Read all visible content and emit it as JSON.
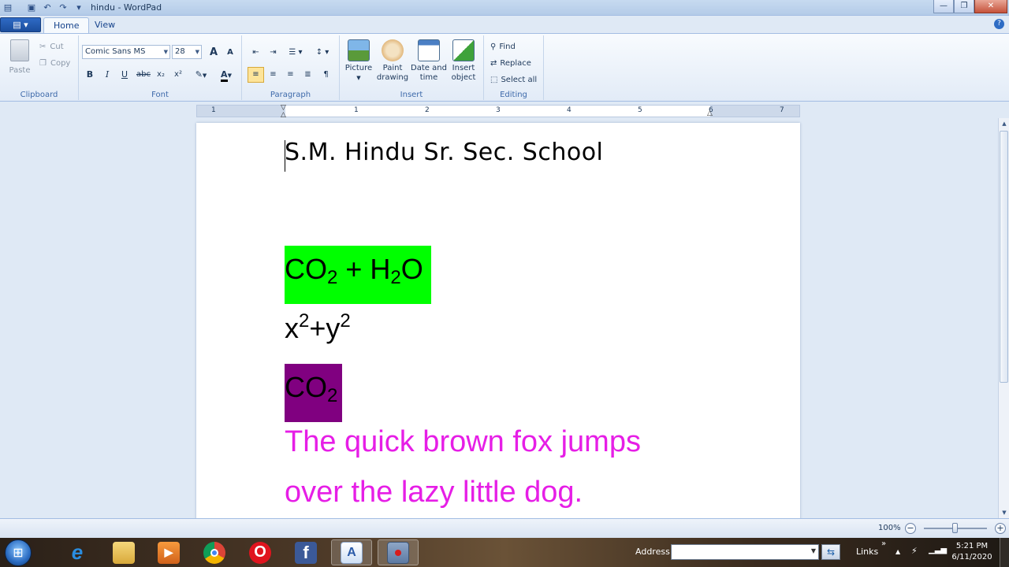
{
  "window": {
    "title": "hindu - WordPad",
    "minimize": "—",
    "maximize": "❐",
    "close": "✕"
  },
  "quick_access": {
    "save_icon": "floppy-icon",
    "undo": "↶",
    "redo": "↷",
    "customize": "▾"
  },
  "tabs": [
    {
      "label": "Home",
      "active": true
    },
    {
      "label": "View",
      "active": false
    }
  ],
  "app_menu": "▤ ▾",
  "help": "?",
  "ribbon": {
    "clipboard": {
      "label": "Clipboard",
      "paste": "Paste",
      "cut": "Cut",
      "copy": "Copy"
    },
    "font": {
      "label": "Font",
      "family": "Comic Sans MS",
      "size": "28",
      "grow": "A",
      "shrink": "A",
      "bold": "B",
      "italic": "I",
      "underline": "U",
      "strike": "abc",
      "subscript": "x₂",
      "superscript": "x²",
      "highlight": "✎",
      "color": "A"
    },
    "paragraph": {
      "label": "Paragraph"
    },
    "insert": {
      "label": "Insert",
      "picture": "Picture",
      "paint": [
        "Paint",
        "drawing"
      ],
      "datetime": [
        "Date and",
        "time"
      ],
      "object": [
        "Insert",
        "object"
      ]
    },
    "editing": {
      "label": "Editing",
      "find": "Find",
      "replace": "Replace",
      "select_all": "Select all"
    }
  },
  "ruler": {
    "numbers": [
      "1",
      "1",
      "2",
      "3",
      "4",
      "5",
      "6",
      "7"
    ]
  },
  "document": {
    "heading": "S.M. Hindu Sr. Sec. School",
    "eq1": {
      "a": "CO",
      "a_sub": "2",
      "plus": " + H",
      "b_sub": "2",
      "c": "O"
    },
    "eq2": {
      "x": "x",
      "x_sup": "2",
      "plus": "+y",
      "y_sup": "2"
    },
    "eq3": {
      "a": "CO",
      "a_sub": "2"
    },
    "sentence_line1": "The quick brown fox jumps",
    "sentence_line2": "over the lazy little dog.",
    "colors": {
      "green_highlight": "#00ff00",
      "purple_highlight": "#800080",
      "magenta_text": "#e61ee6"
    }
  },
  "status": {
    "zoom": "100%",
    "zoom_out": "−",
    "zoom_in": "+"
  },
  "taskbar": {
    "apps": [
      "internet-explorer",
      "file-explorer",
      "media-player",
      "chrome",
      "opera",
      "facebook",
      "wordpad",
      "save"
    ],
    "address_label": "Address",
    "address_value": "",
    "go": "⇆",
    "links_label": "Links",
    "links_chevron": "»",
    "tray_up": "▲",
    "time": "5:21 PM",
    "date": "6/11/2020"
  }
}
